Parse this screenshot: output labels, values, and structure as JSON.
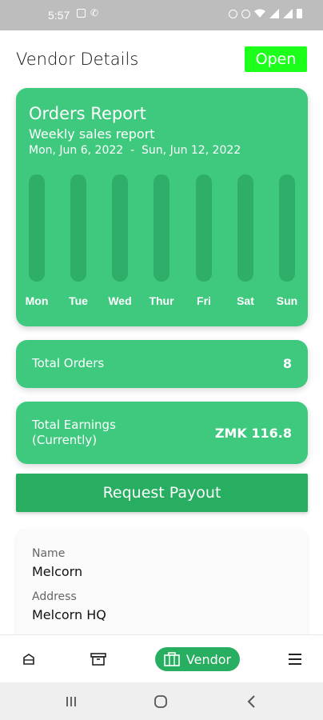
{
  "status_bar": {
    "time": "5:57"
  },
  "header": {
    "title": "Vendor Details",
    "status_badge": "Open"
  },
  "report": {
    "title": "Orders Report",
    "subtitle": "Weekly sales report",
    "date_range": "Mon, Jun 6, 2022  -  Sun, Jun 12, 2022",
    "days": [
      "Mon",
      "Tue",
      "Wed",
      "Thur",
      "Fri",
      "Sat",
      "Sun"
    ]
  },
  "total_orders": {
    "label": "Total Orders",
    "value": "8"
  },
  "total_earnings": {
    "label_line1": "Total Earnings",
    "label_line2": "(Currently)",
    "value": "ZMK 116.8"
  },
  "payout_button": {
    "label": "Request Payout"
  },
  "vendor_info": {
    "name_label": "Name",
    "name_value": "Melcorn",
    "address_label": "Address",
    "address_value": "Melcorn HQ"
  },
  "bottom_nav": {
    "active_label": "Vendor",
    "items": [
      "orders-box-icon",
      "archive-icon",
      "vendor-icon",
      "menu-icon"
    ]
  },
  "colors": {
    "card_green": "#3ec97e",
    "button_green": "#27ae60",
    "open_badge": "#1bff1b",
    "bar_track": "#2fae69"
  }
}
